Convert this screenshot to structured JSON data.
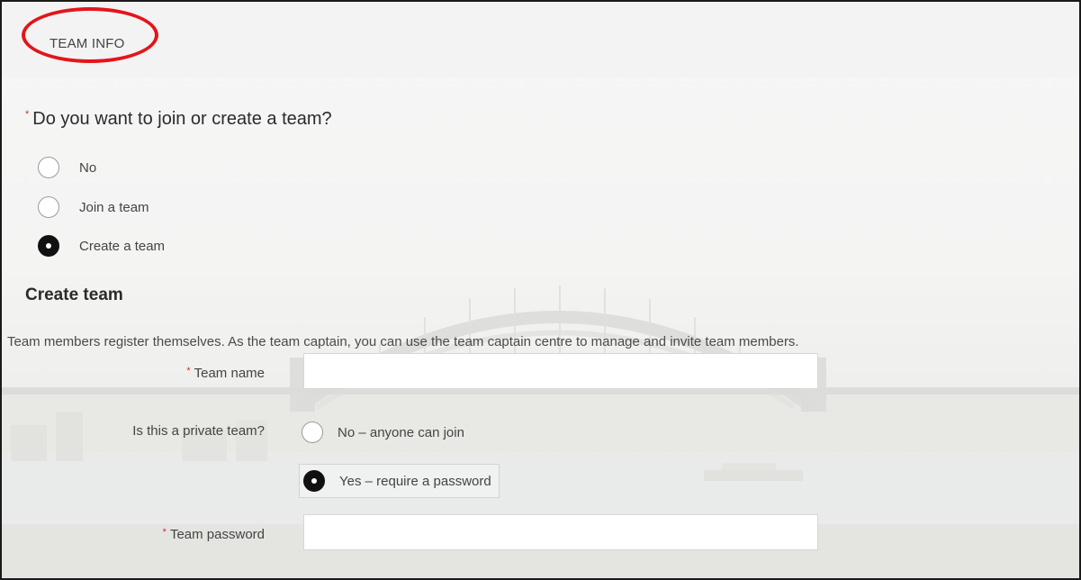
{
  "section_header": "TEAM INFO",
  "question": {
    "required_mark": "*",
    "label": "Do you want to join or create a team?"
  },
  "join_options": [
    {
      "label": "No",
      "checked": false
    },
    {
      "label": "Join a team",
      "checked": false
    },
    {
      "label": "Create a team",
      "checked": true
    }
  ],
  "create_team": {
    "heading": "Create team",
    "description": "Team members register themselves. As the team captain, you can use the team captain centre to manage and invite team members."
  },
  "team_name": {
    "required_mark": "*",
    "label": "Team name",
    "value": ""
  },
  "private_team": {
    "label": "Is this a private team?",
    "options": [
      {
        "label": "No – anyone can join",
        "checked": false
      },
      {
        "label": "Yes – require a password",
        "checked": true
      }
    ]
  },
  "team_password": {
    "required_mark": "*",
    "label": "Team password",
    "value": ""
  },
  "colors": {
    "annotation": "#e3151a",
    "required": "#c0392b",
    "radio_checked": "#111111"
  }
}
